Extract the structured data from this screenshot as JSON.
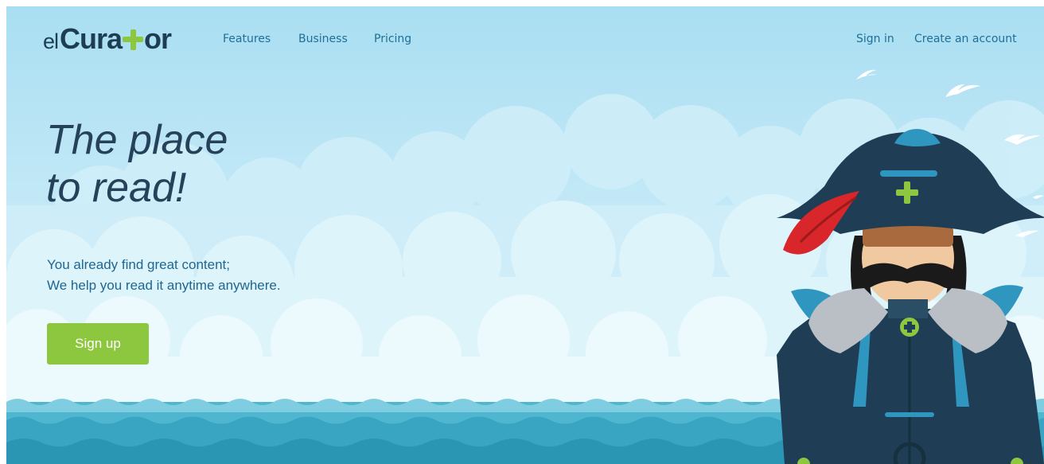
{
  "logo": {
    "prefix": "el",
    "word_start": "Cura",
    "word_end": "or"
  },
  "nav": {
    "features": "Features",
    "business": "Business",
    "pricing": "Pricing",
    "sign_in": "Sign in",
    "create_account": "Create an account"
  },
  "hero": {
    "headline_line1": "The place",
    "headline_line2": "to read!",
    "sub_line1": "You already find great content;",
    "sub_line2": "We help you read it anytime anywhere.",
    "cta": "Sign up"
  },
  "colors": {
    "brand_green": "#8dc73f",
    "brand_navy": "#1d3d52",
    "link_blue": "#1f6f98",
    "sea": "#4fb6cf"
  },
  "icons": [
    "plus-icon",
    "seagull-icon",
    "pirate-mascot"
  ]
}
